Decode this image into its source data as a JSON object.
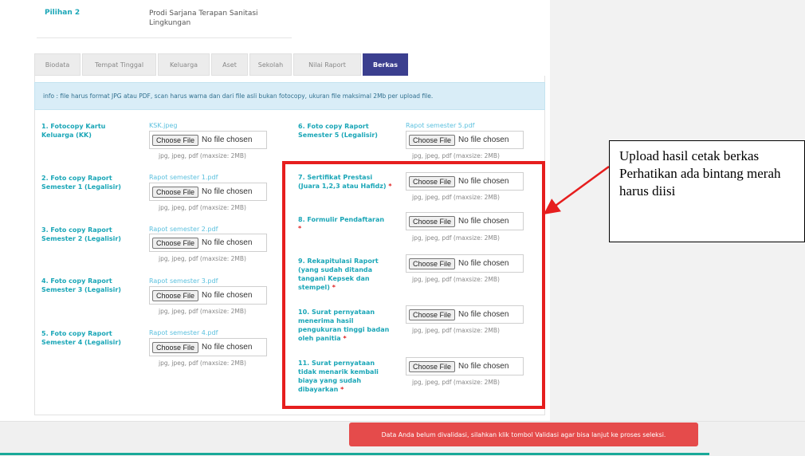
{
  "choice": {
    "label": "Pilihan 2",
    "value": "Prodi Sarjana Terapan Sanitasi Lingkungan"
  },
  "tabs": [
    {
      "label": "Biodata",
      "active": false
    },
    {
      "label": "Tempat Tinggal",
      "active": false
    },
    {
      "label": "Keluarga",
      "active": false
    },
    {
      "label": "Aset",
      "active": false
    },
    {
      "label": "Sekolah",
      "active": false
    },
    {
      "label": "Nilai Raport",
      "active": false
    },
    {
      "label": "Berkas",
      "active": true
    }
  ],
  "info": "info : file harus format JPG atau PDF, scan harus warna dan dari file asli bukan fotocopy, ukuran file maksimal 2Mb per upload file.",
  "file_input": {
    "choose": "Choose File",
    "none": "No file chosen"
  },
  "hint": "jpg, jpeg, pdf (maxsize: 2MB)",
  "left_items": [
    {
      "label": "1. Fotocopy Kartu Keluarga (KK)",
      "file": "KSK.jpeg"
    },
    {
      "label": "2. Foto copy Raport Semester 1 (Legalisir)",
      "file": "Rapot semester 1.pdf"
    },
    {
      "label": "3. Foto copy Raport Semester 2 (Legalisir)",
      "file": "Rapot semester 2.pdf"
    },
    {
      "label": "4. Foto copy Raport Semester 3 (Legalisir)",
      "file": "Rapot semester 3.pdf"
    },
    {
      "label": "5. Foto copy Raport Semester 4 (Legalisir)",
      "file": "Rapot semester 4.pdf"
    }
  ],
  "right_items": [
    {
      "label": "6. Foto copy Raport Semester 5 (Legalisir)",
      "file": "Rapot semester 5.pdf",
      "required": false
    },
    {
      "label": "7. Sertifikat Prestasi (Juara 1,2,3 atau Hafidz)",
      "file": "",
      "required": true
    },
    {
      "label": "8. Formulir Pendaftaran",
      "file": "",
      "required": true
    },
    {
      "label": "9. Rekapitulasi Raport (yang sudah ditanda tangani Kepsek dan stempel)",
      "file": "",
      "required": true
    },
    {
      "label": "10. Surat pernyataan menerima hasil pengukuran tinggi badan oleh panitia",
      "file": "",
      "required": true
    },
    {
      "label": "11. Surat pernyataan tidak menarik kembali biaya yang sudah dibayarkan",
      "file": "",
      "required": true
    }
  ],
  "star": "*",
  "callout_lines": [
    "Upload hasil cetak berkas",
    "Perhatikan ada bintang merah harus diisi"
  ],
  "toast": "Data Anda belum divalidasi, silahkan klik tombol Validasi agar bisa lanjut ke proses seleksi.",
  "colors": {
    "accent": "#1aa6b7",
    "tab_active": "#3b3f8f",
    "highlight": "#e61e1e",
    "toast": "#e54b4b"
  }
}
